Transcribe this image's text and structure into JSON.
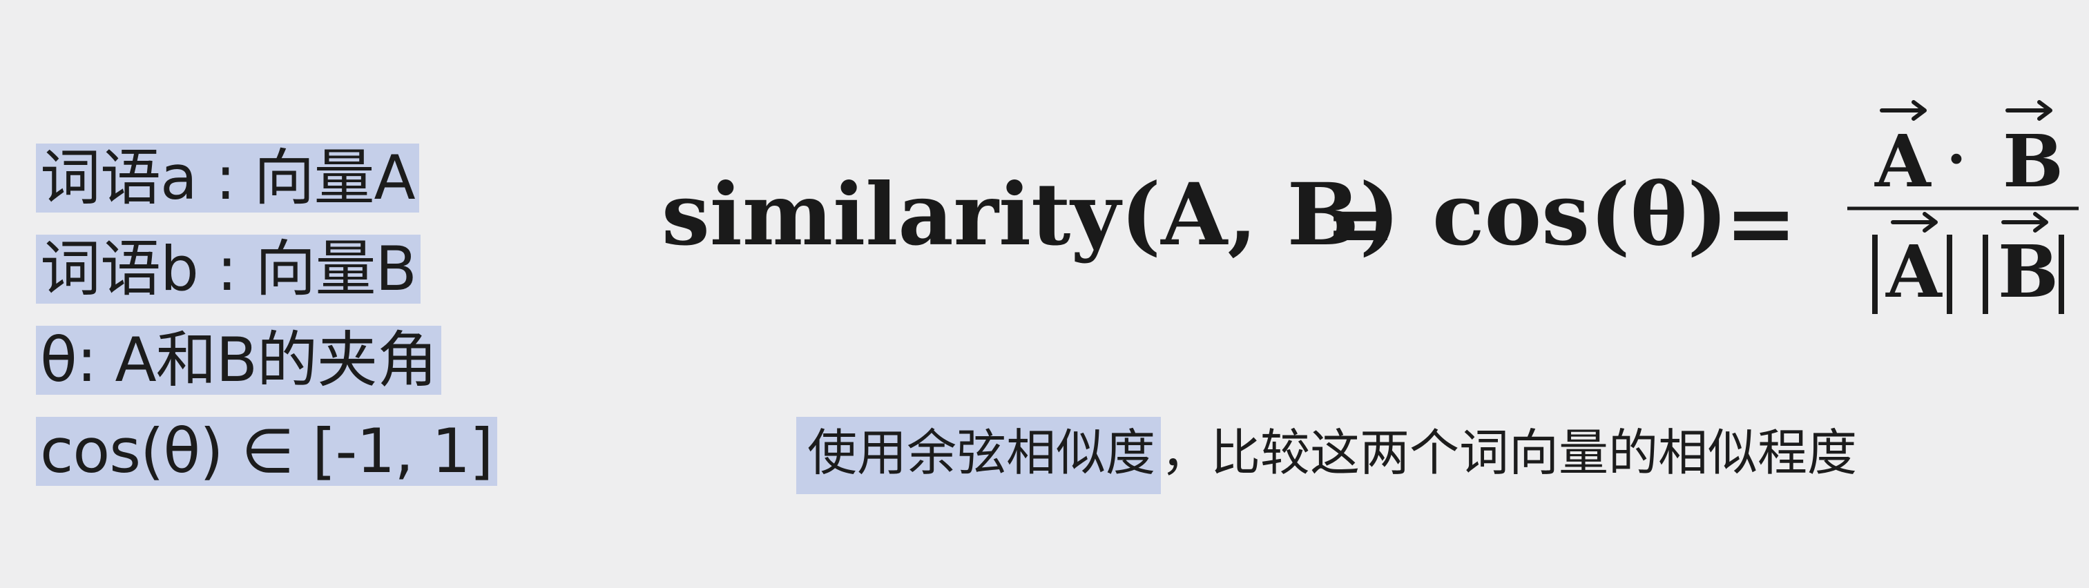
{
  "definitions": {
    "word_a": "词语a : 向量A",
    "word_b": "词语b : 向量B",
    "theta": "θ: A和B的夹角",
    "cos_range": "cos(θ) ∈ [-1, 1]"
  },
  "formula": {
    "lhs": "similarity(A, B)",
    "equals": "=",
    "middle": "cos(θ)",
    "numerator_a": "A",
    "dot": "·",
    "numerator_b": "B",
    "denominator_a": "A",
    "denominator_b": "B"
  },
  "caption": {
    "highlighted": "使用余弦相似度",
    "rest": "，比较这两个词向量的相似程度"
  },
  "colors": {
    "background": "#eeeeef",
    "highlight": "#c5cfe9",
    "text": "#1c1c1c"
  }
}
